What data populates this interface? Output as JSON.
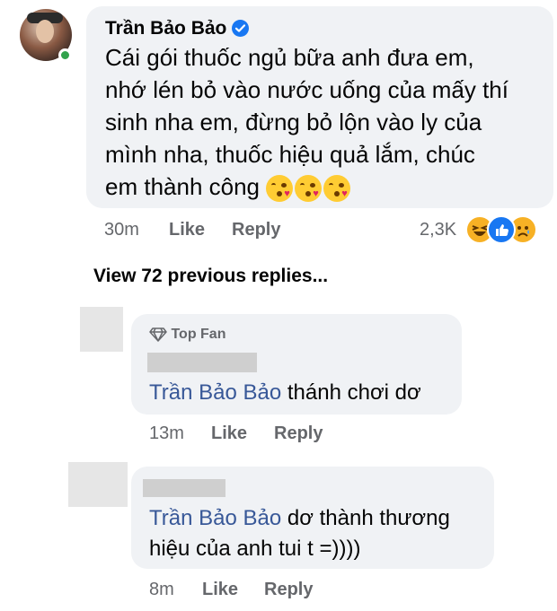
{
  "main_comment": {
    "author": "Trần Bảo Bảo",
    "text": "Cái gói thuốc ngủ bữa anh đưa em,\nnhớ lén bỏ vào nước uống của mấy thí\nsinh nha em, đừng bỏ lộn vào ly của\nmình nha, thuốc hiệu quả lắm, chúc\nem thành công",
    "emojis": [
      "face-blowing-kiss-emoji",
      "face-blowing-kiss-emoji",
      "face-blowing-kiss-emoji"
    ],
    "time": "30m",
    "like_label": "Like",
    "reply_label": "Reply",
    "reaction_count": "2,3K",
    "reactions": [
      "haha",
      "like",
      "sad"
    ]
  },
  "view_more": "View 72 previous replies...",
  "replies": [
    {
      "badge": "Top Fan",
      "mention": "Trần Bảo Bảo",
      "text": " thánh chơi dơ",
      "time": "13m",
      "like_label": "Like",
      "reply_label": "Reply"
    },
    {
      "mention": "Trần Bảo Bảo",
      "text_line1": " dơ thành thương",
      "text_line2": "hiệu của anh tui t =))))",
      "time": "8m",
      "like_label": "Like",
      "reply_label": "Reply"
    }
  ],
  "colors": {
    "bubble": "#f0f2f5",
    "verified": "#1877f2",
    "mention": "#385898",
    "secondary_text": "#65676b",
    "online": "#31a24c"
  }
}
